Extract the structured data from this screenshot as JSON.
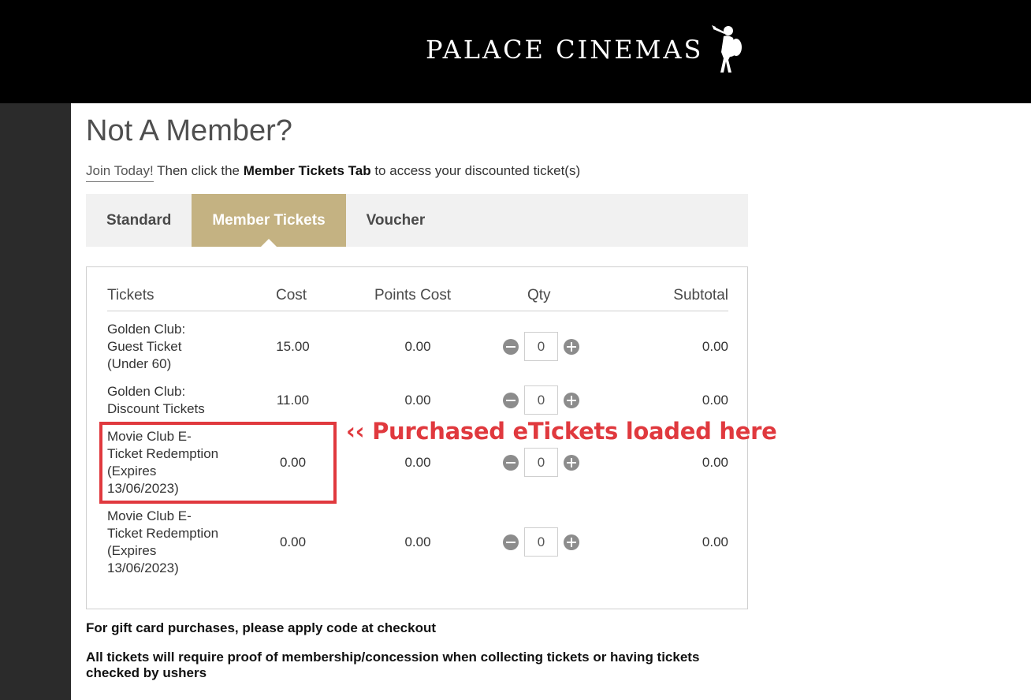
{
  "header": {
    "logo_text": "PALACE CINEMAS"
  },
  "page": {
    "title": "Not A Member?",
    "join_link": "Join Today!",
    "intro_mid": " Then click the ",
    "intro_bold": "Member Tickets Tab",
    "intro_end": " to access your discounted ticket(s)"
  },
  "tabs": [
    {
      "label": "Standard",
      "active": false
    },
    {
      "label": "Member Tickets",
      "active": true
    },
    {
      "label": "Voucher",
      "active": false
    }
  ],
  "table": {
    "headers": {
      "tickets": "Tickets",
      "cost": "Cost",
      "points": "Points Cost",
      "qty": "Qty",
      "subtotal": "Subtotal"
    },
    "rows": [
      {
        "line1": "Golden Club:",
        "line2": "Guest Ticket",
        "line3": "(Under 60)",
        "line4": "",
        "cost": "15.00",
        "points": "0.00",
        "qty": "0",
        "subtotal": "0.00"
      },
      {
        "line1": "Golden Club:",
        "line2": "Discount Tickets",
        "line3": "",
        "line4": "",
        "cost": "11.00",
        "points": "0.00",
        "qty": "0",
        "subtotal": "0.00"
      },
      {
        "line1": "Movie Club E-",
        "line2": "Ticket Redemption",
        "line3": "(Expires",
        "line4": "13/06/2023)",
        "cost": "0.00",
        "points": "0.00",
        "qty": "0",
        "subtotal": "0.00"
      },
      {
        "line1": "Movie Club E-",
        "line2": "Ticket Redemption",
        "line3": "(Expires",
        "line4": "13/06/2023)",
        "cost": "0.00",
        "points": "0.00",
        "qty": "0",
        "subtotal": "0.00"
      }
    ]
  },
  "annotation": {
    "text": "‹‹ Purchased eTickets loaded here",
    "color": "#e0393e"
  },
  "notes": {
    "gift_card": "For gift card purchases, please apply code at checkout",
    "proof": "All tickets will require proof of membership/concession when collecting tickets or having tickets checked by ushers"
  },
  "colors": {
    "accent": "#c4b282",
    "header_bg": "#000000",
    "sidebar_bg": "#2b2b2b"
  }
}
